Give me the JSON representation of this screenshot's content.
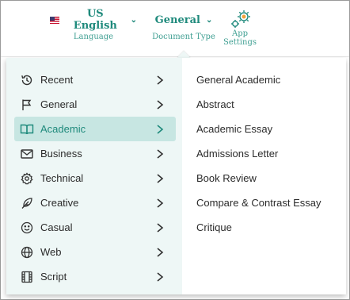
{
  "toolbar": {
    "language": {
      "value": "US English",
      "label": "Language",
      "icon": "us-flag-icon"
    },
    "document_type": {
      "value": "General",
      "label": "Document Type"
    },
    "app_settings": {
      "label": "App Settings",
      "icon": "gears-icon"
    }
  },
  "categories": [
    {
      "label": "Recent",
      "icon": "history-icon",
      "active": false
    },
    {
      "label": "General",
      "icon": "flag-icon",
      "active": false
    },
    {
      "label": "Academic",
      "icon": "book-icon",
      "active": true
    },
    {
      "label": "Business",
      "icon": "envelope-icon",
      "active": false
    },
    {
      "label": "Technical",
      "icon": "gear-icon",
      "active": false
    },
    {
      "label": "Creative",
      "icon": "feather-icon",
      "active": false
    },
    {
      "label": "Casual",
      "icon": "smile-icon",
      "active": false
    },
    {
      "label": "Web",
      "icon": "globe-icon",
      "active": false
    },
    {
      "label": "Script",
      "icon": "film-icon",
      "active": false
    }
  ],
  "document_types": [
    "General Academic",
    "Abstract",
    "Academic Essay",
    "Admissions Letter",
    "Book Review",
    "Compare & Contrast Essay",
    "Critique"
  ],
  "colors": {
    "accent": "#1f8a7c",
    "active_bg": "#c7e6e2",
    "panel_bg": "#eef7f6",
    "text": "#2b2b2b"
  }
}
